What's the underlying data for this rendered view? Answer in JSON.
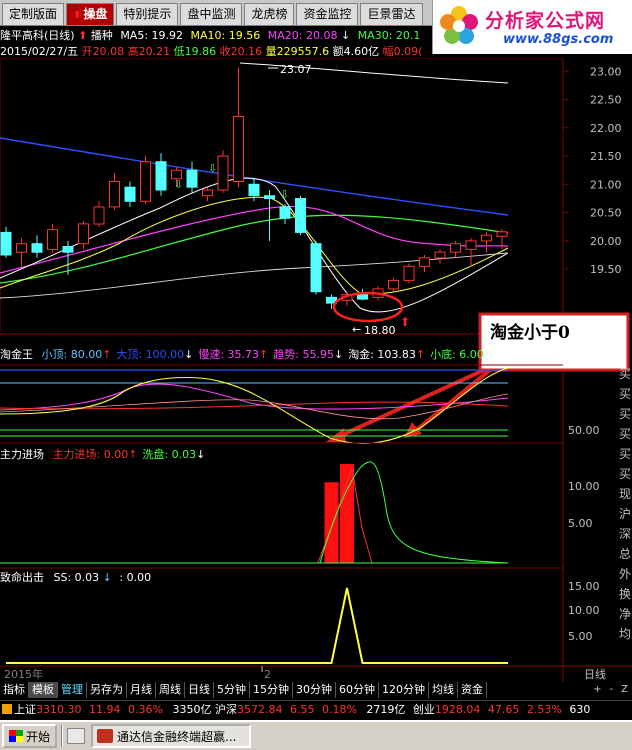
{
  "tabs": [
    {
      "label": "定制版面",
      "active": false,
      "arrow": false
    },
    {
      "label": "操盘",
      "active": true,
      "arrow": true
    },
    {
      "label": "特别提示",
      "active": false,
      "arrow": false
    },
    {
      "label": "盘中监测",
      "active": false,
      "arrow": false
    },
    {
      "label": "龙虎榜",
      "active": false,
      "arrow": false
    },
    {
      "label": "资金监控",
      "active": false,
      "arrow": false
    },
    {
      "label": "巨景雷达",
      "active": false,
      "arrow": false
    }
  ],
  "logo": {
    "brand": "分析家公式网",
    "url": "www.88gs.com"
  },
  "info1": {
    "stock": "隆平高科(日线)",
    "bozhong": "播种",
    "ma5": "MA5: 19.92",
    "ma10": "MA10: 19.56",
    "ma20": "MA20: 20.08",
    "ma30": "MA30: 20.1"
  },
  "info2": {
    "date": "2015/02/27/五",
    "open": "开20.08",
    "high": "高20.21",
    "low": "低19.86",
    "close": "收20.16",
    "vol": "量229557.6",
    "amount": "额4.60亿",
    "amp": "幅0.09("
  },
  "price_axis": [
    "23.00",
    "22.50",
    "22.00",
    "21.50",
    "21.00",
    "20.50",
    "20.00",
    "19.50"
  ],
  "annotations": {
    "high": "23.07",
    "low": "18.80",
    "callout": "淘金小于0"
  },
  "panel2": {
    "name": "淘金王",
    "labels": [
      {
        "text": "小顶: 80.00",
        "color": "#60c0ff"
      },
      {
        "text": "大顶: 100.00",
        "color": "#3050ff"
      },
      {
        "text": "慢速: 35.73",
        "color": "#ff40ff"
      },
      {
        "text": "趋势: 55.95",
        "color": "#ff40ff"
      },
      {
        "text": "淘金: 103.83",
        "color": "#ffffff"
      },
      {
        "text": "小底: 6.00",
        "color": "#40ff40"
      }
    ],
    "axis": "50.00"
  },
  "panel3": {
    "name": "主力进场",
    "labels": [
      {
        "text": "主力进场: 0.00",
        "color": "#ff3030"
      },
      {
        "text": "洗盘: 0.03",
        "color": "#40ff40"
      }
    ],
    "axis": [
      "10.00",
      "5.00"
    ]
  },
  "panel4": {
    "name": "致命出击",
    "label_ss": "SS: 0.03",
    "label_2": ": 0.00",
    "axis": [
      "15.00",
      "10.00",
      "5.00"
    ]
  },
  "x_axis": {
    "year": "2015年",
    "mark": "2",
    "period": "日线"
  },
  "right_side_chars": [
    "买",
    "买",
    "买",
    "买",
    "买",
    "买",
    "现",
    "沪",
    "深",
    "总",
    "外",
    "换",
    "净",
    "均"
  ],
  "bottom_menu": [
    "指标",
    "模板",
    "管理",
    "另存为",
    "月线",
    "周线",
    "日线",
    "5分钟",
    "15分钟",
    "30分钟",
    "60分钟",
    "120分钟",
    "均线",
    "资金"
  ],
  "nav_buttons": [
    "+",
    "-",
    "Z"
  ],
  "quotes": {
    "sh_label": "上证",
    "sh_index": "3310.30",
    "sh_change": "11.94",
    "sh_pct": "0.36%",
    "sh_amt": "3350亿",
    "sz_label": "沪深",
    "sz_index": "3572.84",
    "sz_change": "6.55",
    "sz_pct": "0.18%",
    "sz_amt": "2719亿",
    "cy_label": "创业",
    "cy_index": "1928.04",
    "cy_change": "47.65",
    "cy_pct": "2.53%",
    "cy_amt": "630"
  },
  "taskbar": {
    "start": "开始",
    "item": "通达信金融终端超赢..."
  },
  "chart_data": {
    "type": "candlestick",
    "ylim": [
      18.6,
      23.2
    ],
    "candles": [
      {
        "o": 20.15,
        "h": 20.25,
        "l": 19.7,
        "c": 19.75
      },
      {
        "o": 19.8,
        "h": 20.05,
        "l": 19.55,
        "c": 19.95
      },
      {
        "o": 19.95,
        "h": 20.1,
        "l": 19.7,
        "c": 19.8
      },
      {
        "o": 19.85,
        "h": 20.3,
        "l": 19.8,
        "c": 20.2
      },
      {
        "o": 19.9,
        "h": 20.0,
        "l": 19.4,
        "c": 19.8
      },
      {
        "o": 19.95,
        "h": 20.35,
        "l": 19.85,
        "c": 20.3
      },
      {
        "o": 20.3,
        "h": 20.7,
        "l": 20.25,
        "c": 20.6
      },
      {
        "o": 20.6,
        "h": 21.2,
        "l": 20.55,
        "c": 21.05
      },
      {
        "o": 20.95,
        "h": 21.05,
        "l": 20.6,
        "c": 20.7
      },
      {
        "o": 20.7,
        "h": 21.5,
        "l": 20.65,
        "c": 21.4
      },
      {
        "o": 21.4,
        "h": 21.55,
        "l": 20.8,
        "c": 20.9
      },
      {
        "o": 21.1,
        "h": 21.3,
        "l": 20.95,
        "c": 21.25
      },
      {
        "o": 21.25,
        "h": 21.4,
        "l": 20.85,
        "c": 20.95
      },
      {
        "o": 20.8,
        "h": 20.95,
        "l": 20.7,
        "c": 20.9
      },
      {
        "o": 20.9,
        "h": 21.6,
        "l": 20.85,
        "c": 21.5
      },
      {
        "o": 21.05,
        "h": 23.07,
        "l": 20.95,
        "c": 22.2
      },
      {
        "o": 21.0,
        "h": 21.1,
        "l": 20.7,
        "c": 20.8
      },
      {
        "o": 20.8,
        "h": 20.9,
        "l": 20.0,
        "c": 20.75
      },
      {
        "o": 20.6,
        "h": 20.65,
        "l": 20.3,
        "c": 20.4
      },
      {
        "o": 20.75,
        "h": 20.8,
        "l": 20.1,
        "c": 20.15
      },
      {
        "o": 19.95,
        "h": 20.0,
        "l": 19.05,
        "c": 19.1
      },
      {
        "o": 19.0,
        "h": 19.05,
        "l": 18.8,
        "c": 18.9
      },
      {
        "o": 18.95,
        "h": 19.1,
        "l": 18.85,
        "c": 19.05
      },
      {
        "o": 19.05,
        "h": 19.15,
        "l": 18.95,
        "c": 18.97
      },
      {
        "o": 19.0,
        "h": 19.2,
        "l": 18.95,
        "c": 19.15
      },
      {
        "o": 19.15,
        "h": 19.35,
        "l": 19.1,
        "c": 19.3
      },
      {
        "o": 19.3,
        "h": 19.6,
        "l": 19.25,
        "c": 19.55
      },
      {
        "o": 19.55,
        "h": 19.75,
        "l": 19.45,
        "c": 19.7
      },
      {
        "o": 19.7,
        "h": 19.85,
        "l": 19.6,
        "c": 19.8
      },
      {
        "o": 19.8,
        "h": 20.0,
        "l": 19.7,
        "c": 19.95
      },
      {
        "o": 19.85,
        "h": 20.05,
        "l": 19.55,
        "c": 20.0
      },
      {
        "o": 20.0,
        "h": 20.15,
        "l": 19.8,
        "c": 20.1
      },
      {
        "o": 20.08,
        "h": 20.21,
        "l": 19.86,
        "c": 20.16
      }
    ],
    "zhuli": [
      0,
      0,
      0,
      0,
      0,
      0,
      0,
      0,
      0,
      0,
      0,
      0,
      0,
      0,
      0,
      0,
      0,
      0,
      0,
      0,
      0,
      11.0,
      13.5,
      0,
      0,
      0,
      0,
      0,
      0,
      0,
      0,
      0,
      0
    ],
    "ss": [
      0,
      0,
      0,
      0,
      0,
      0,
      0,
      0,
      0,
      0,
      0,
      0,
      0,
      0,
      0,
      0,
      0,
      0,
      0,
      0,
      0,
      0,
      15.0,
      0,
      0,
      0,
      0,
      0,
      0,
      0,
      0,
      0,
      0
    ]
  }
}
